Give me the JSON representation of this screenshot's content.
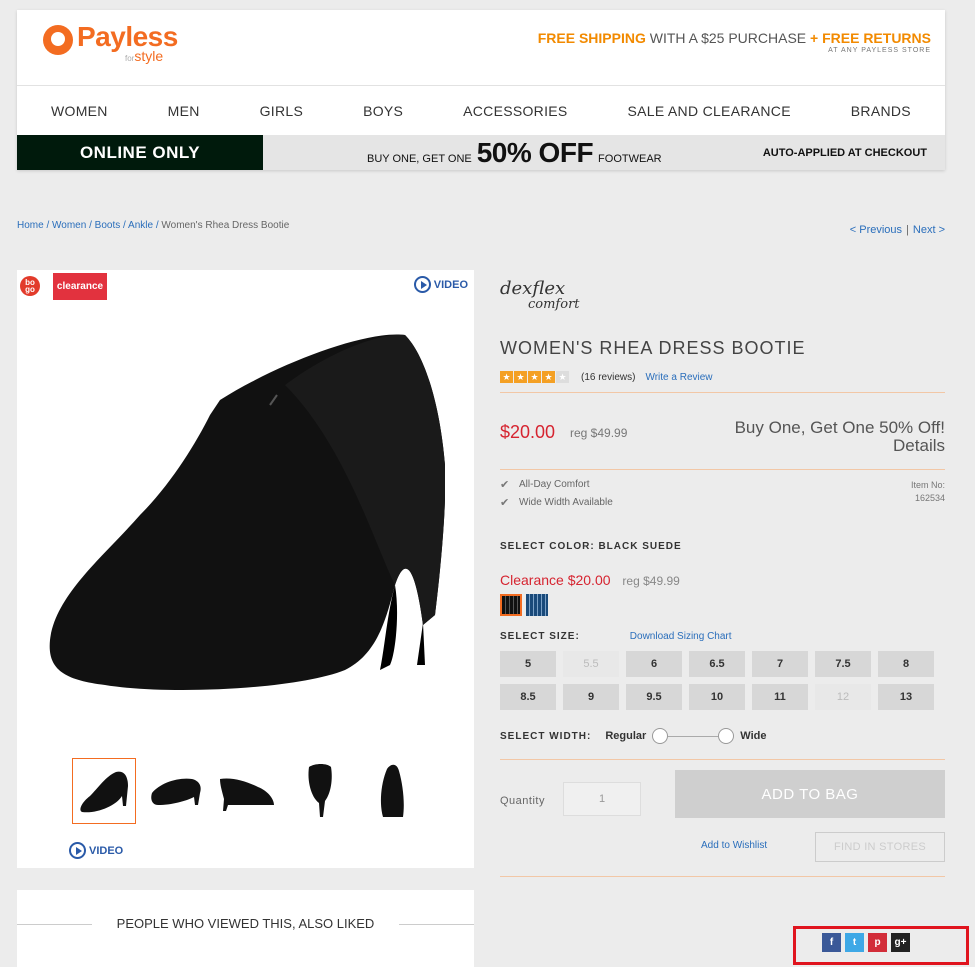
{
  "header": {
    "logo_word": "Payless",
    "logo_small": "for",
    "logo_sub": "style",
    "free_shipping": "FREE SHIPPING",
    "shipping_mid": "WITH A $25 PURCHASE",
    "free_returns": "+ FREE RETURNS",
    "returns_sub": "AT ANY PAYLESS STORE"
  },
  "nav": [
    "WOMEN",
    "MEN",
    "GIRLS",
    "BOYS",
    "ACCESSORIES",
    "SALE AND CLEARANCE",
    "BRANDS"
  ],
  "banner": {
    "left": "ONLINE ONLY",
    "mid_pre": "BUY ONE, GET ONE",
    "mid_big": "50% OFF",
    "mid_post": "FOOTWEAR",
    "right": "AUTO-APPLIED AT CHECKOUT"
  },
  "breadcrumb": {
    "home": "Home",
    "women": "Women",
    "boots": "Boots",
    "ankle": "Ankle",
    "current": "Women's Rhea Dress Bootie",
    "sep": " / ",
    "previous": "< Previous",
    "pipe": "|",
    "next": "Next >"
  },
  "image_panel": {
    "bogo_badge": "bo go",
    "clearance_badge": "clearance",
    "video_label": "VIDEO"
  },
  "also_liked": "PEOPLE WHO VIEWED THIS, ALSO LIKED",
  "product": {
    "brand_top": "dexflex",
    "brand_sub": "comfort",
    "name": "WOMEN'S RHEA DRESS BOOTIE",
    "rating": 4,
    "rating_max": 5,
    "reviews": "(16 reviews)",
    "write_review": "Write a Review",
    "price": "$20.00",
    "reg_price": "reg $49.99",
    "bogo_line": "Buy One, Get One 50% Off!",
    "details": "Details",
    "features": [
      "All-Day Comfort",
      "Wide Width Available"
    ],
    "item_no_label": "Item No:",
    "item_no": "162534",
    "select_color": "SELECT COLOR: BLACK SUEDE",
    "clearance_price": "Clearance $20.00",
    "clearance_reg": "reg $49.99",
    "select_size": "SELECT SIZE:",
    "sizing_chart": "Download Sizing Chart",
    "sizes": [
      {
        "label": "5",
        "available": true
      },
      {
        "label": "5.5",
        "available": false
      },
      {
        "label": "6",
        "available": true
      },
      {
        "label": "6.5",
        "available": true
      },
      {
        "label": "7",
        "available": true
      },
      {
        "label": "7.5",
        "available": true
      },
      {
        "label": "8",
        "available": true
      },
      {
        "label": "8.5",
        "available": true
      },
      {
        "label": "9",
        "available": true
      },
      {
        "label": "9.5",
        "available": true
      },
      {
        "label": "10",
        "available": true
      },
      {
        "label": "11",
        "available": true
      },
      {
        "label": "12",
        "available": false
      },
      {
        "label": "13",
        "available": true
      }
    ],
    "select_width": "SELECT WIDTH:",
    "width_regular": "Regular",
    "width_wide": "Wide",
    "quantity_label": "Quantity",
    "quantity_value": "1",
    "add_to_bag": "ADD TO BAG",
    "add_to_wishlist": "Add to Wishlist",
    "find_in_stores": "FIND IN STORES"
  },
  "social": {
    "facebook": "f",
    "twitter": "t",
    "pinterest": "p",
    "googleplus": "g+"
  },
  "colors": {
    "brand_orange": "#f36c21",
    "price_red": "#d62430",
    "link_blue": "#2a6ebb",
    "highlight_box": "#e0141e"
  }
}
